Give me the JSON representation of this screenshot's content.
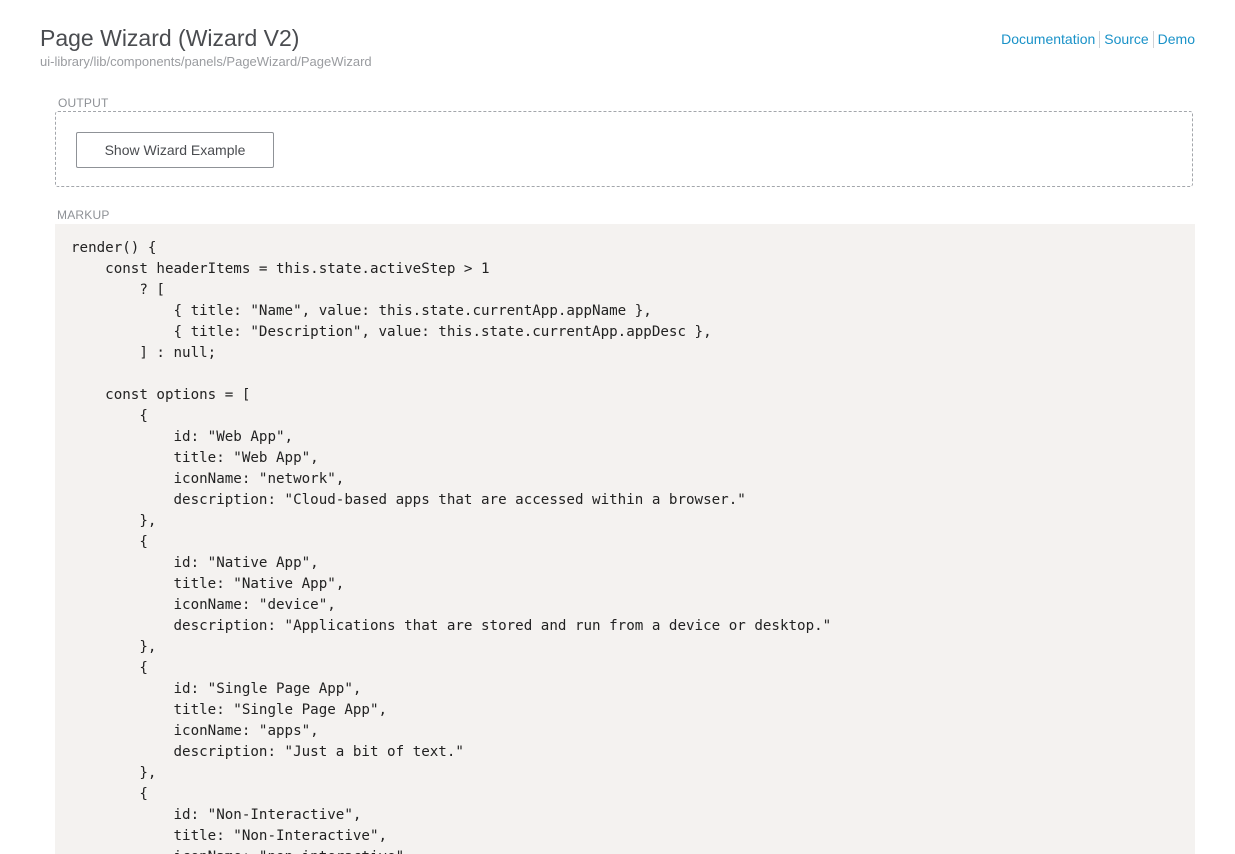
{
  "header": {
    "title": "Page Wizard (Wizard V2)",
    "path": "ui-library/lib/components/panels/PageWizard/PageWizard",
    "links": [
      {
        "label": "Documentation"
      },
      {
        "label": "Source"
      },
      {
        "label": "Demo"
      }
    ]
  },
  "output": {
    "label": "OUTPUT",
    "button_label": "Show Wizard Example"
  },
  "markup": {
    "label": "MARKUP",
    "code_lines": [
      "render() {",
      "    const headerItems = this.state.activeStep > 1",
      "        ? [",
      "            { title: \"Name\", value: this.state.currentApp.appName },",
      "            { title: \"Description\", value: this.state.currentApp.appDesc },",
      "        ] : null;",
      "",
      "    const options = [",
      "        {",
      "            id: \"Web App\",",
      "            title: \"Web App\",",
      "            iconName: \"network\",",
      "            description: \"Cloud-based apps that are accessed within a browser.\"",
      "        },",
      "        {",
      "            id: \"Native App\",",
      "            title: \"Native App\",",
      "            iconName: \"device\",",
      "            description: \"Applications that are stored and run from a device or desktop.\"",
      "        },",
      "        {",
      "            id: \"Single Page App\",",
      "            title: \"Single Page App\",",
      "            iconName: \"apps\",",
      "            description: \"Just a bit of text.\"",
      "        },",
      "        {",
      "            id: \"Non-Interactive\",",
      "            title: \"Non-Interactive\",",
      "            iconName: \"non-interactive\","
    ]
  }
}
